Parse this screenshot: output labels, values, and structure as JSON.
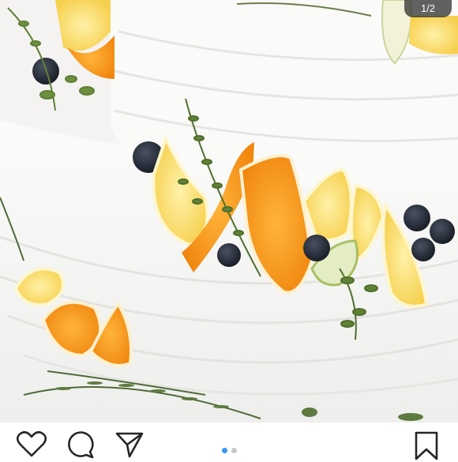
{
  "post": {
    "photo": {
      "subject": "cake-with-citrus-and-blueberries",
      "counter_text": "1/2"
    },
    "carousel": {
      "current": 1,
      "total": 2,
      "active_color": "#3897f0",
      "inactive_color": "#c8c8c8"
    },
    "actions": {
      "like_icon": "heart-icon",
      "comment_icon": "comment-icon",
      "share_icon": "paper-plane-icon",
      "save_icon": "bookmark-icon"
    }
  }
}
